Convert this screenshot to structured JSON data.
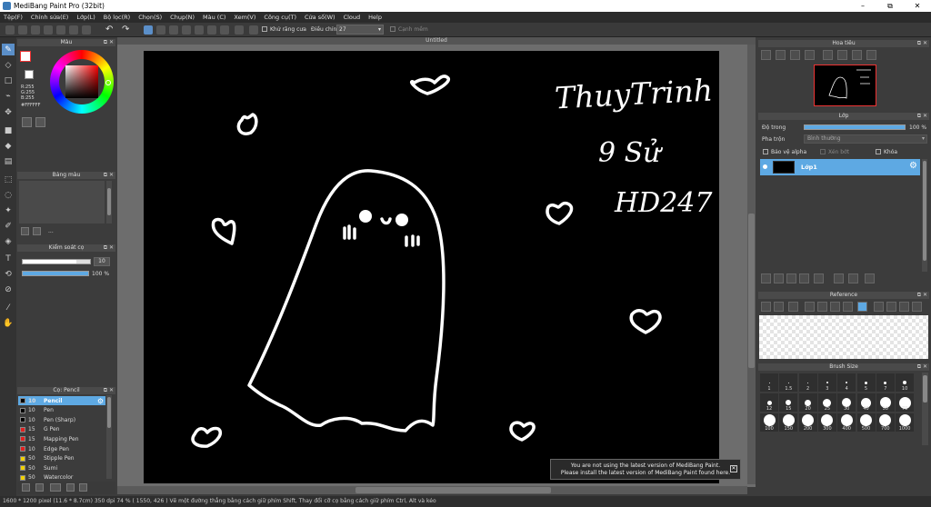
{
  "window": {
    "title": "MediBang Paint Pro (32bit)",
    "min": "–",
    "max": "⧉",
    "close": "✕"
  },
  "menu": [
    "Tệp(F)",
    "Chỉnh sửa(E)",
    "Lớp(L)",
    "Bộ lọc(R)",
    "Chọn(S)",
    "Chụp(N)",
    "Màu (C)",
    "Xem(V)",
    "Công cụ(T)",
    "Cửa số(W)",
    "Cloud",
    "Help"
  ],
  "toolbar": {
    "antialias_label": "Khử răng cưa",
    "adjust_label": "Điều chỉnh",
    "adjust_value": "27",
    "edge_label": "Cạnh mềm"
  },
  "color_panel": {
    "title": "Màu",
    "r": "R:255",
    "g": "G:255",
    "b": "B:255",
    "hex": "#FFFFFF"
  },
  "palette_panel": {
    "title": "Bảng màu",
    "dots": "..."
  },
  "brush_control": {
    "title": "Kiểm soát cọ",
    "size": "10",
    "opacity": "100 %",
    "size_fraction": 0.8,
    "opacity_fraction": 1.0
  },
  "brush_panel": {
    "title": "Cọ: Pencil",
    "items": [
      {
        "size": "10",
        "name": "Pencil",
        "color": "#000000",
        "selected": true
      },
      {
        "size": "10",
        "name": "Pen",
        "color": "#000000"
      },
      {
        "size": "10",
        "name": "Pen (Sharp)",
        "color": "#000000"
      },
      {
        "size": "15",
        "name": "G Pen",
        "color": "#e02020"
      },
      {
        "size": "15",
        "name": "Mapping Pen",
        "color": "#e02020"
      },
      {
        "size": "10",
        "name": "Edge Pen",
        "color": "#e02020"
      },
      {
        "size": "50",
        "name": "Stipple Pen",
        "color": "#f0d000"
      },
      {
        "size": "50",
        "name": "Sumi",
        "color": "#f0d000"
      },
      {
        "size": "50",
        "name": "Watercolor",
        "color": "#f0d000"
      }
    ]
  },
  "document": {
    "tab": "Untitled"
  },
  "canvas_text": {
    "line1": "ThuyTrinh",
    "line2": "9 Sử",
    "line3": "HD247"
  },
  "notice": {
    "line1": "You are not using the latest version of MediBang Paint.",
    "line2": "Please install the latest version of MediBang Paint found here.",
    "close": "✕"
  },
  "navigator": {
    "title": "Hoa tiêu"
  },
  "layer_panel": {
    "title": "Lớp",
    "opacity_label": "Độ trong",
    "opacity_value": "100 %",
    "opacity_fraction": 1.0,
    "blend_label": "Pha trộn",
    "blend_value": "Bình thường",
    "protect_alpha": "Bảo vệ alpha",
    "clipping": "Xén bớt",
    "lock": "Khóa",
    "layer_name": "Lớp1"
  },
  "reference": {
    "title": "Reference"
  },
  "brush_size": {
    "title": "Brush Size",
    "sizes": [
      [
        "1",
        "1.5",
        "2",
        "3",
        "4",
        "5",
        "7",
        "10"
      ],
      [
        "12",
        "15",
        "20",
        "25",
        "30",
        "40",
        "50",
        "70"
      ],
      [
        "100",
        "150",
        "200",
        "300",
        "400",
        "500",
        "700",
        "1000"
      ]
    ]
  },
  "status": {
    "text": "1600 * 1200 pixel   (11.6 * 8.7cm)   350 dpi   74 %   ( 1550, 426 )   Vẽ một đường thẳng bằng cách giữ phím Shift, Thay đổi cỡ cọ bằng cách giữ phím Ctrl, Alt và kéo"
  }
}
